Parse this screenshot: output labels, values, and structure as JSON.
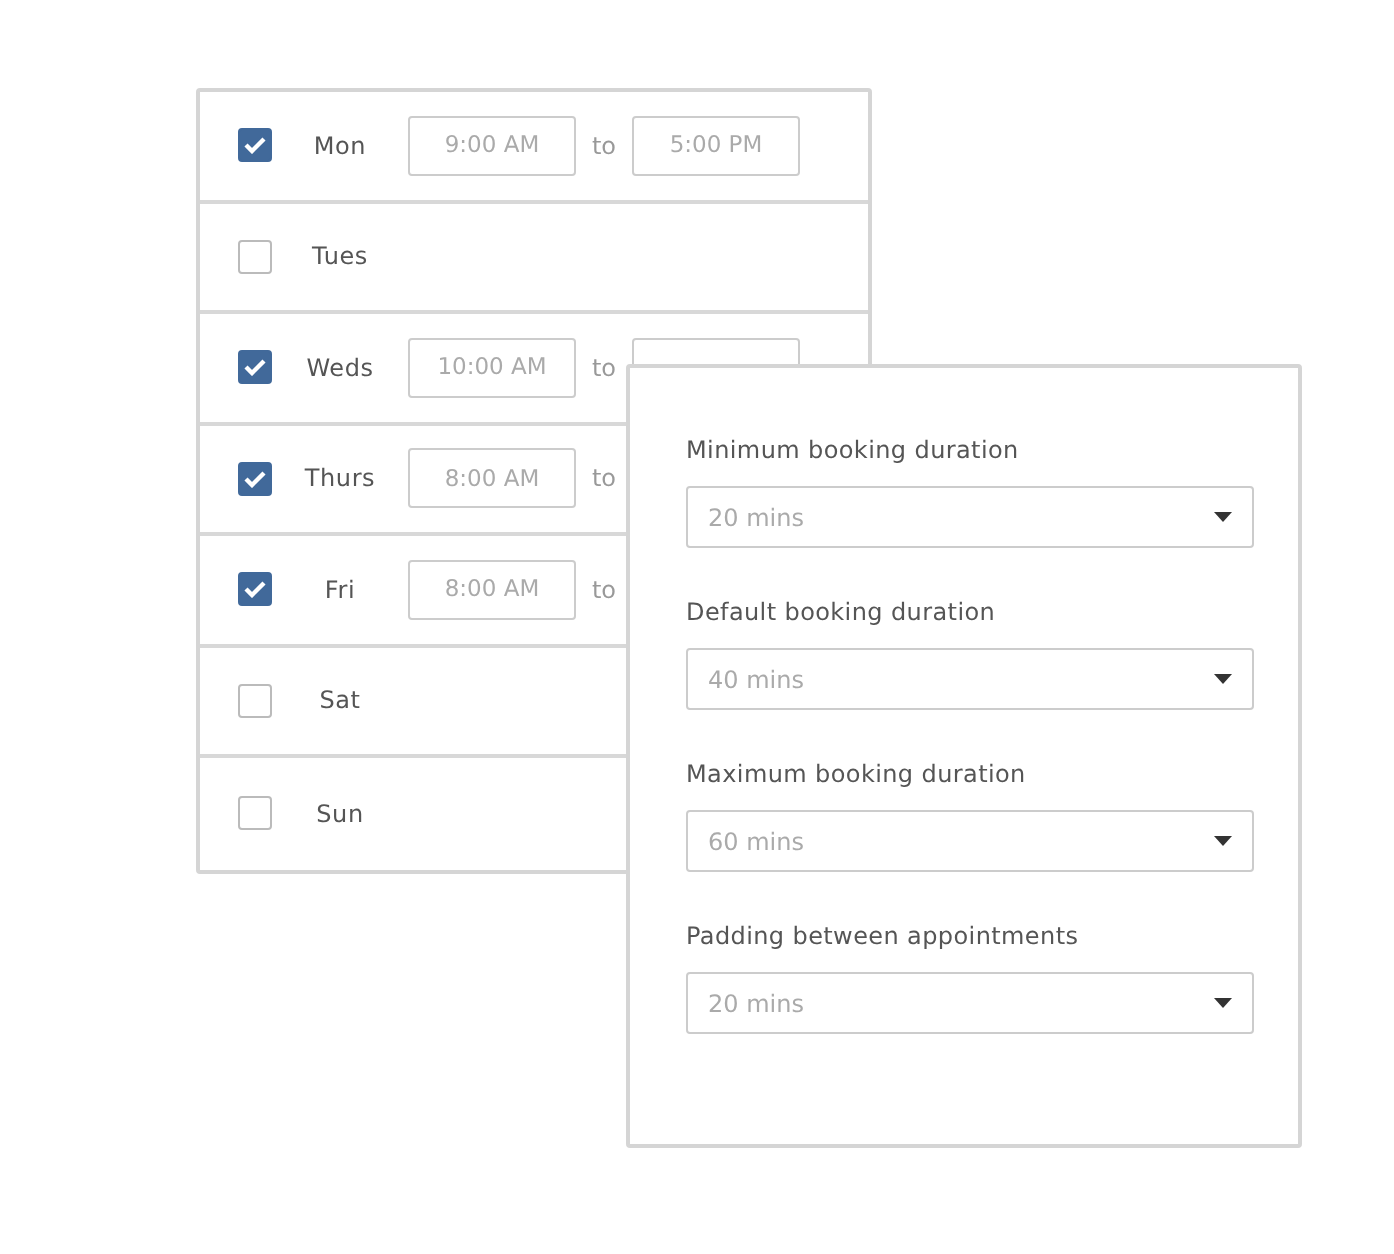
{
  "days": [
    {
      "label": "Mon",
      "checked": true,
      "start": "9:00 AM",
      "to": "to",
      "end": "5:00 PM"
    },
    {
      "label": "Tues",
      "checked": false
    },
    {
      "label": "Weds",
      "checked": true,
      "start": "10:00 AM",
      "to": "to"
    },
    {
      "label": "Thurs",
      "checked": true,
      "start": "8:00 AM",
      "to": "to"
    },
    {
      "label": "Fri",
      "checked": true,
      "start": "8:00 AM",
      "to": "to"
    },
    {
      "label": "Sat",
      "checked": false
    },
    {
      "label": "Sun",
      "checked": false
    }
  ],
  "settings": [
    {
      "label": "Minimum booking duration",
      "value": "20 mins"
    },
    {
      "label": "Default booking duration",
      "value": "40 mins"
    },
    {
      "label": "Maximum booking duration",
      "value": "60 mins"
    },
    {
      "label": "Padding between appointments",
      "value": "20 mins"
    }
  ]
}
